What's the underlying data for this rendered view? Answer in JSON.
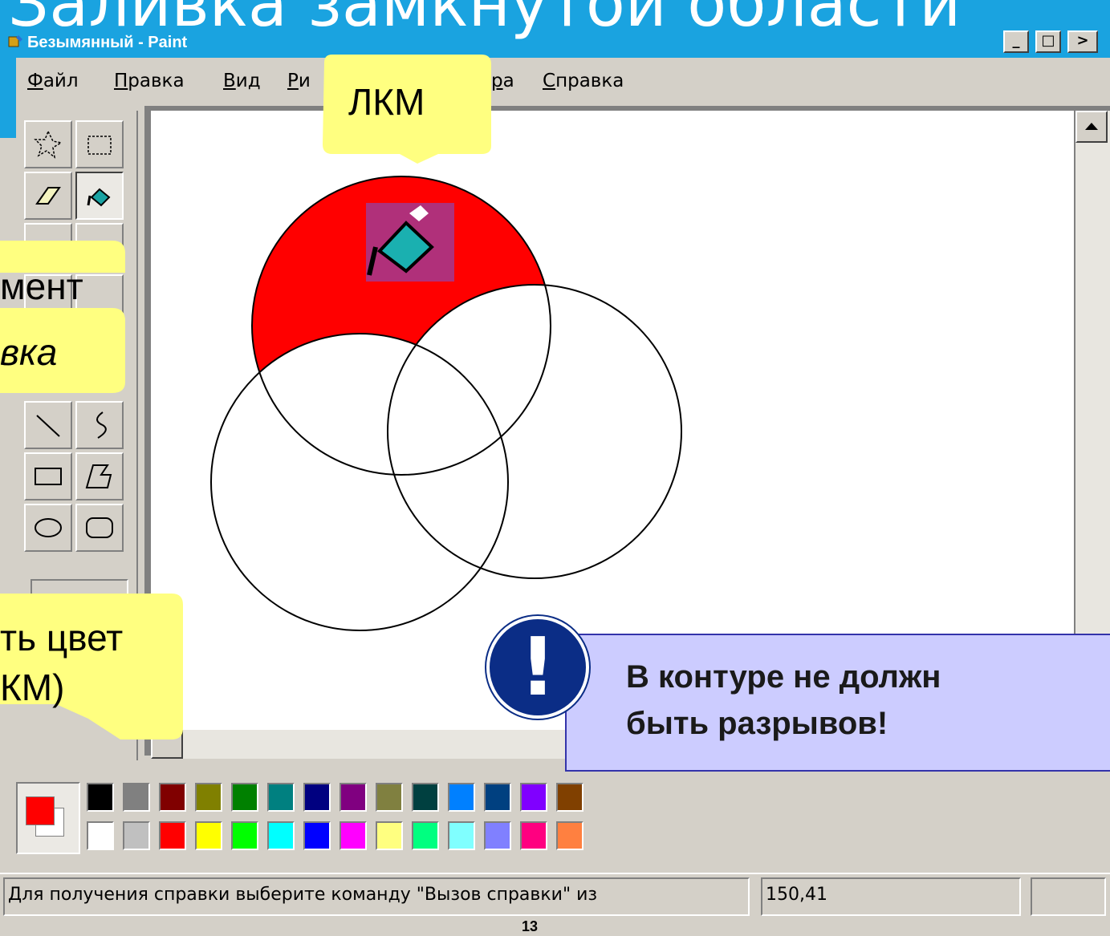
{
  "slide": {
    "title": "Заливка замкнутой области",
    "page_number": "13"
  },
  "window": {
    "title": "Безымянный - Paint",
    "buttons": {
      "minimize": "_",
      "maximize": "□",
      "scroll_right": ">"
    }
  },
  "menu": {
    "items": [
      {
        "label": "Файл"
      },
      {
        "label": "Правка"
      },
      {
        "label": "Вид"
      },
      {
        "label": "Ри"
      },
      {
        "label": "ра"
      },
      {
        "label": "Справка"
      }
    ]
  },
  "toolbox": {
    "tools": [
      {
        "name": "free-select-icon"
      },
      {
        "name": "rect-select-icon"
      },
      {
        "name": "eraser-icon"
      },
      {
        "name": "fill-bucket-icon",
        "active": true
      },
      {
        "name": "line-icon"
      },
      {
        "name": "curve-icon"
      },
      {
        "name": "rectangle-icon"
      },
      {
        "name": "polygon-icon"
      },
      {
        "name": "ellipse-icon"
      },
      {
        "name": "rounded-rect-icon"
      }
    ]
  },
  "callouts": {
    "lkm": "ЛКМ",
    "tool_line1": "мент",
    "tool_line2": "вка",
    "color_line1": "ть цвет",
    "color_line2": "КМ)"
  },
  "note": {
    "mark": "!",
    "line1": "В контуре не должн",
    "line2": "быть разрывов!"
  },
  "palette": {
    "primary_color": "#ff0000",
    "secondary_color": "#ffffff",
    "top_row": [
      "#000000",
      "#808080",
      "#800000",
      "#808000",
      "#008000",
      "#008080",
      "#000080",
      "#800080",
      "#808040",
      "#004040",
      "#0080ff",
      "#004080",
      "#8000ff",
      "#804000"
    ],
    "bottom_row": [
      "#ffffff",
      "#c0c0c0",
      "#ff0000",
      "#ffff00",
      "#00ff00",
      "#00ffff",
      "#0000ff",
      "#ff00ff",
      "#ffff80",
      "#00ff80",
      "#80ffff",
      "#8080ff",
      "#ff0080",
      "#ff8040"
    ]
  },
  "statusbar": {
    "help_text": "Для получения справки выберите команду \"Вызов справки\" из",
    "coords": "150,41"
  },
  "colors": {
    "fill_red": "#ff0000",
    "callout_yellow": "#ffff80",
    "note_bg": "#ccccff",
    "title_blue": "#1aa3e0"
  }
}
